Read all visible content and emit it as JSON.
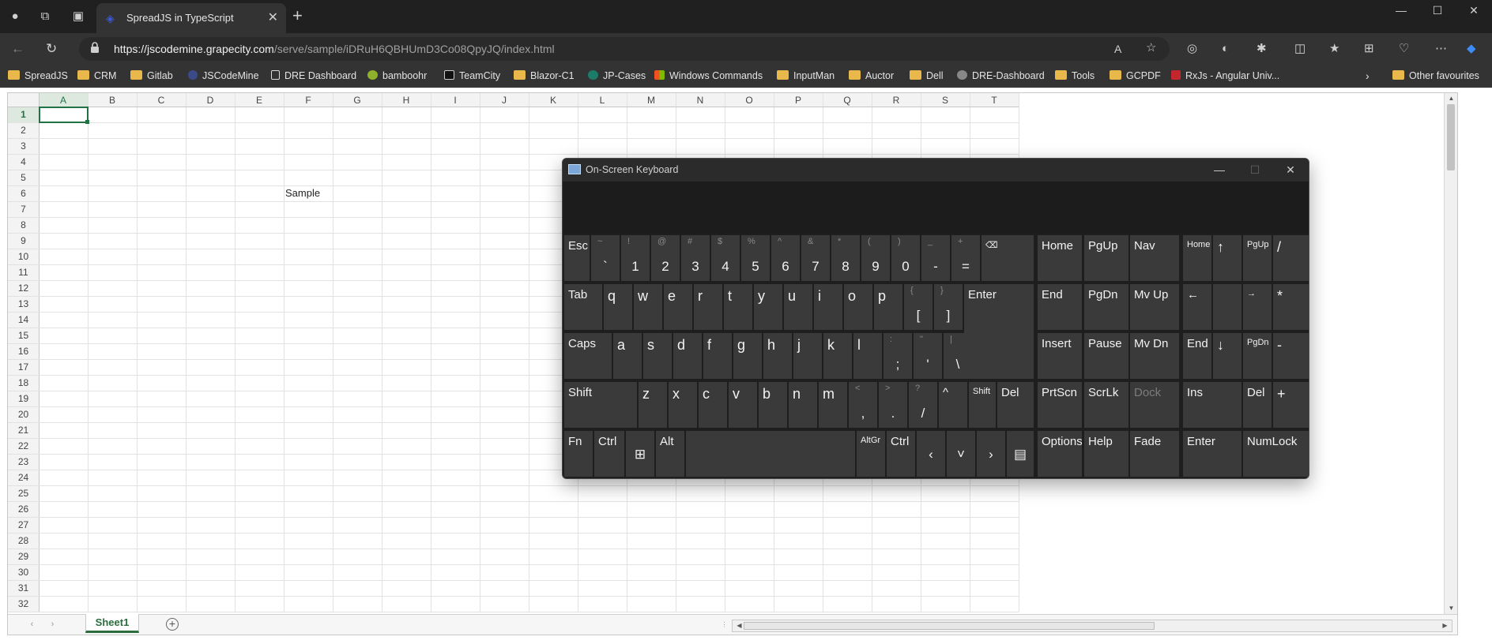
{
  "browser": {
    "tab_title": "SpreadJS in TypeScript",
    "url_host": "https://jscodemine.grapecity.com",
    "url_path": "/serve/sample/iDRuH6QBHUmD3Co08QpyJQ/index.html",
    "bookmarks": [
      "SpreadJS",
      "CRM",
      "Gitlab",
      "JSCodeMine",
      "DRE Dashboard",
      "bamboohr",
      "TeamCity",
      "Blazor-C1",
      "JP-Cases",
      "Windows Commands",
      "InputMan",
      "Auctor",
      "Dell",
      "DRE-Dashboard",
      "Tools",
      "GCPDF",
      "RxJs - Angular Univ...",
      "Other favourites"
    ],
    "reader_icon_label": "A",
    "accent_color": "#1a73e8"
  },
  "spreadsheet": {
    "columns": [
      "A",
      "B",
      "C",
      "D",
      "E",
      "F",
      "G",
      "H",
      "I",
      "J",
      "K",
      "L",
      "M",
      "N",
      "O",
      "P",
      "Q",
      "R",
      "S",
      "T"
    ],
    "rows": [
      "1",
      "2",
      "3",
      "4",
      "5",
      "6",
      "7",
      "8",
      "9",
      "10",
      "11",
      "12",
      "13",
      "14",
      "15",
      "16",
      "17",
      "18",
      "19",
      "20",
      "21",
      "22",
      "23",
      "24",
      "25",
      "26",
      "27",
      "28",
      "29",
      "30",
      "31",
      "32"
    ],
    "active_cell": "A1",
    "cells": [
      {
        "ref": "F6",
        "value": "Sample"
      }
    ],
    "sheet_tab": "Sheet1",
    "selection_color": "#217346"
  },
  "osk": {
    "title": "On-Screen Keyboard",
    "row1": [
      {
        "main": "Esc"
      },
      {
        "shift": "~",
        "main": "`"
      },
      {
        "shift": "!",
        "main": "1"
      },
      {
        "shift": "@",
        "main": "2"
      },
      {
        "shift": "#",
        "main": "3"
      },
      {
        "shift": "$",
        "main": "4"
      },
      {
        "shift": "%",
        "main": "5"
      },
      {
        "shift": "^",
        "main": "6"
      },
      {
        "shift": "&",
        "main": "7"
      },
      {
        "shift": "*",
        "main": "8"
      },
      {
        "shift": "(",
        "main": "9"
      },
      {
        "shift": ")",
        "main": "0"
      },
      {
        "shift": "_",
        "main": "-"
      },
      {
        "shift": "+",
        "main": "="
      },
      {
        "main": "⌫"
      }
    ],
    "row2": [
      {
        "main": "Tab"
      },
      {
        "main": "q"
      },
      {
        "main": "w"
      },
      {
        "main": "e"
      },
      {
        "main": "r"
      },
      {
        "main": "t"
      },
      {
        "main": "y"
      },
      {
        "main": "u"
      },
      {
        "main": "i"
      },
      {
        "main": "o"
      },
      {
        "main": "p"
      },
      {
        "shift": "{",
        "main": "["
      },
      {
        "shift": "}",
        "main": "]"
      },
      {
        "main": "Enter"
      }
    ],
    "row3": [
      {
        "main": "Caps"
      },
      {
        "main": "a"
      },
      {
        "main": "s"
      },
      {
        "main": "d"
      },
      {
        "main": "f"
      },
      {
        "main": "g"
      },
      {
        "main": "h"
      },
      {
        "main": "j"
      },
      {
        "main": "k"
      },
      {
        "main": "l"
      },
      {
        "shift": ":",
        "main": ";"
      },
      {
        "shift": "\"",
        "main": "'"
      },
      {
        "shift": "|",
        "main": "\\"
      }
    ],
    "row4": [
      {
        "main": "Shift"
      },
      {
        "main": "z"
      },
      {
        "main": "x"
      },
      {
        "main": "c"
      },
      {
        "main": "v"
      },
      {
        "main": "b"
      },
      {
        "main": "n"
      },
      {
        "main": "m"
      },
      {
        "shift": "<",
        "main": ","
      },
      {
        "shift": ">",
        "main": "."
      },
      {
        "shift": "?",
        "main": "/"
      },
      {
        "main": "^"
      },
      {
        "main": "Shift"
      },
      {
        "main": "Del"
      }
    ],
    "row5": [
      {
        "main": "Fn"
      },
      {
        "main": "Ctrl"
      },
      {
        "main": "⊞"
      },
      {
        "main": "Alt"
      },
      {
        "main": ""
      },
      {
        "main": "AltGr"
      },
      {
        "main": "Ctrl"
      },
      {
        "main": "‹"
      },
      {
        "main": "˅"
      },
      {
        "main": "›"
      },
      {
        "main": "▤"
      }
    ],
    "nav_keys": [
      {
        "main": "Home"
      },
      {
        "main": "PgUp"
      },
      {
        "main": "Nav"
      },
      {
        "main": "End"
      },
      {
        "main": "PgDn"
      },
      {
        "main": "Mv Up"
      },
      {
        "main": "Insert"
      },
      {
        "main": "Pause"
      },
      {
        "main": "Mv Dn"
      },
      {
        "main": "PrtScn"
      },
      {
        "main": "ScrLk"
      },
      {
        "main": "Dock"
      },
      {
        "main": "Options"
      },
      {
        "main": "Help"
      },
      {
        "main": "Fade"
      }
    ],
    "numpad_keys": [
      {
        "main": "Home"
      },
      {
        "main": "↑"
      },
      {
        "main": "PgUp"
      },
      {
        "main": "/"
      },
      {
        "main": "←"
      },
      {
        "main": ""
      },
      {
        "main": "→"
      },
      {
        "main": "*"
      },
      {
        "main": "End"
      },
      {
        "main": "↓"
      },
      {
        "main": "PgDn"
      },
      {
        "main": "-"
      },
      {
        "main": "Ins"
      },
      {
        "main": "Del"
      },
      {
        "main": "+"
      },
      {
        "main": "Enter"
      },
      {
        "main": "NumLock"
      }
    ]
  }
}
